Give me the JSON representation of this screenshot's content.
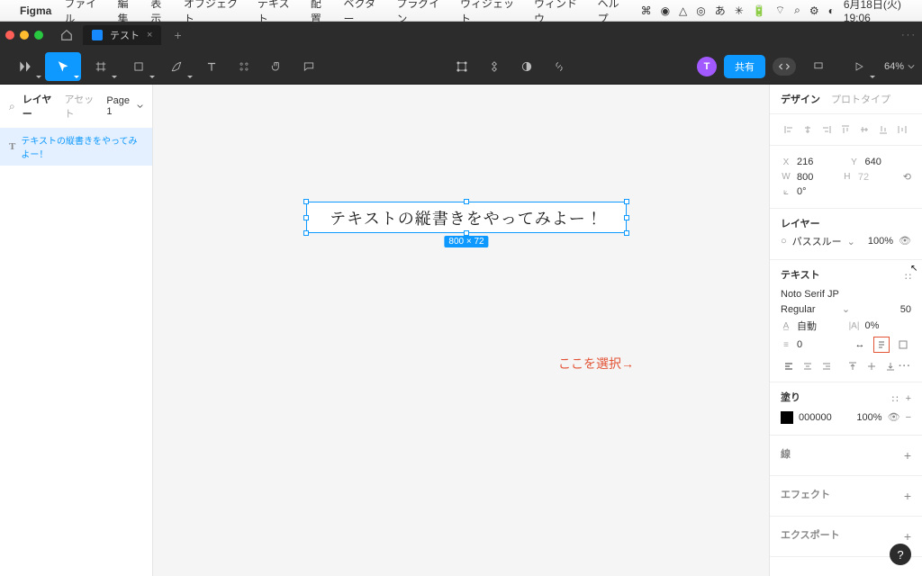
{
  "mac": {
    "app": "Figma",
    "menus": [
      "ファイル",
      "編集",
      "表示",
      "オブジェクト",
      "テキスト",
      "配置",
      "ベクター",
      "プラグイン",
      "ウィジェット",
      "ウィンドウ",
      "ヘルプ"
    ],
    "ime": "あ",
    "clock": "6月18日(火)  19:06"
  },
  "titlebar": {
    "tab_name": "テスト",
    "tab_close": "×",
    "plus": "+",
    "menu_dots": "···"
  },
  "toolbar": {
    "zoom": "64%"
  },
  "left": {
    "layers_label": "レイヤー",
    "assets_label": "アセット",
    "page_label": "Page 1",
    "layer_name": "テキストの縦書きをやってみよー！"
  },
  "canvas": {
    "text": "テキストの縦書きをやってみよー！",
    "dims": "800 × 72",
    "annotation": "ここを選択→"
  },
  "right": {
    "tab_design": "デザイン",
    "tab_proto": "プロトタイプ",
    "x_label": "X",
    "x_val": "216",
    "y_label": "Y",
    "y_val": "640",
    "w_label": "W",
    "w_val": "800",
    "h_label": "H",
    "h_val": "72",
    "rot": "0°",
    "layer_title": "レイヤー",
    "blend": "パススルー",
    "opacity": "100%",
    "text_title": "テキスト",
    "font": "Noto Serif JP",
    "weight": "Regular",
    "size": "50",
    "lineheight": "自動",
    "letterspacing": "0%",
    "para": "0",
    "fills_title": "塗り",
    "fill_hex": "000000",
    "fill_opacity": "100%",
    "stroke_title": "線",
    "effects_title": "エフェクト",
    "export_title": "エクスポート",
    "share": "共有",
    "avatar": "T",
    "help": "?"
  }
}
